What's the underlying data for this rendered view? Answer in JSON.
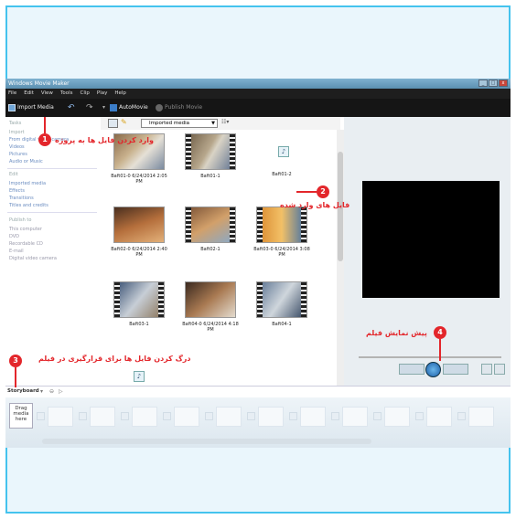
{
  "window": {
    "title": "Windows Movie Maker",
    "buttons": [
      "_",
      "□",
      "x"
    ]
  },
  "menu": [
    "File",
    "Edit",
    "View",
    "Tools",
    "Clip",
    "Play",
    "Help"
  ],
  "toolbar": {
    "import_media": "Import Media",
    "automovie": "AutoMovie",
    "publish_movie": "Publish Movie"
  },
  "tasks": {
    "header_tasks": "Tasks",
    "header_import": "Import",
    "import_items": [
      "From digital video camera",
      "Videos",
      "Pictures",
      "Audio or Music"
    ],
    "header_edit": "Edit",
    "edit_items": [
      "Imported media",
      "Effects",
      "Transitions",
      "Titles and credits"
    ],
    "header_publish": "Publish to",
    "publish_items": [
      "This computer",
      "DVD",
      "Recordable CD",
      "E-mail",
      "Digital video camera"
    ]
  },
  "collection_bar": {
    "selected_collection": "Imported media"
  },
  "clips": [
    {
      "caption": "Baft01-0 6/24/2014 2:05 PM",
      "kind": "video"
    },
    {
      "caption": "Baft01-1",
      "kind": "film"
    },
    {
      "caption": "Baft01-2",
      "kind": "audio"
    },
    {
      "caption": "Baft02-0 6/24/2014 2:40 PM",
      "kind": "video"
    },
    {
      "caption": "Baft02-1",
      "kind": "film"
    },
    {
      "caption": "Baft03-0 6/24/2014 3:08 PM",
      "kind": "film"
    },
    {
      "caption": "Baft03-1",
      "kind": "film"
    },
    {
      "caption": "Baft04-0 6/24/2014 4:18 PM",
      "kind": "film"
    },
    {
      "caption": "Baft04-1",
      "kind": "film"
    }
  ],
  "storyboard": {
    "label": "Storyboard",
    "drag_hint": "Drag media here"
  },
  "annotations": {
    "a1": "وارد کردن فایل ها به پروژه",
    "a2": "فایل های وارد شده",
    "a3": "درگ کردن فایل ها برای قرارگیری در فیلم",
    "a4": "پیش نمایش فیلم",
    "n1": "1",
    "n2": "2",
    "n3": "3",
    "n4": "4"
  },
  "colors": {
    "frame_border": "#45c3ee",
    "frame_bg": "#eaf6fc",
    "annotation_red": "#e3262b"
  }
}
